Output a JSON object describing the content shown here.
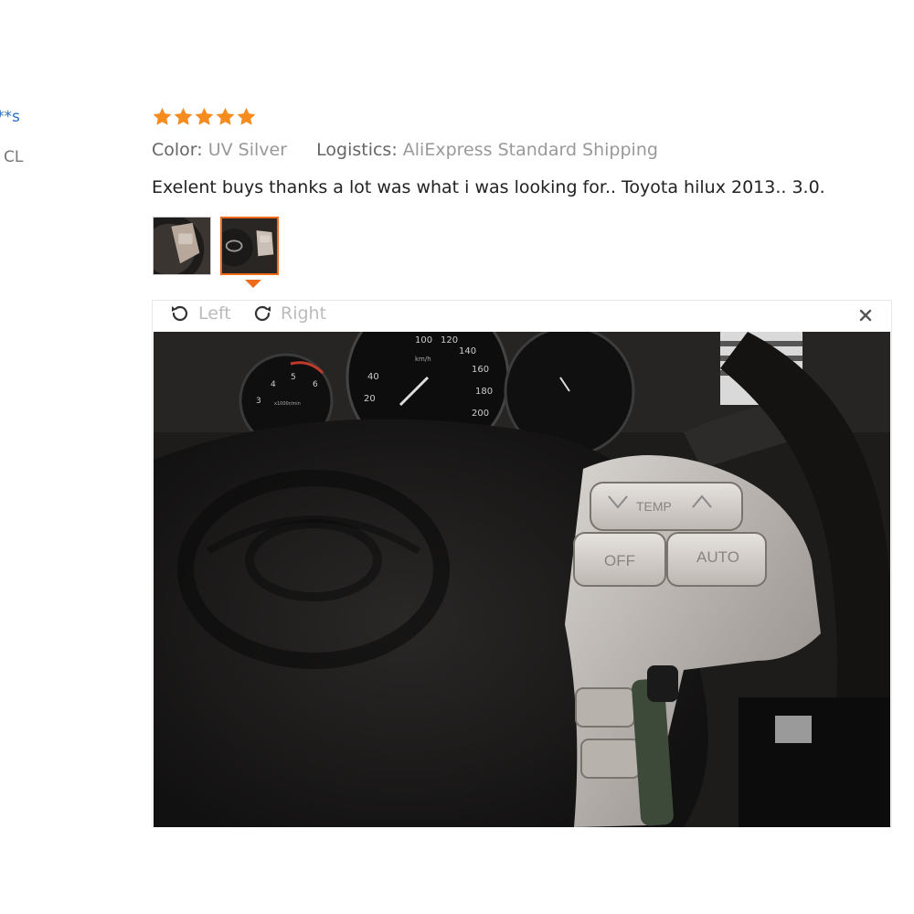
{
  "reviewer": {
    "name": "**s",
    "country": "CL"
  },
  "review": {
    "rating": 5,
    "color_label": "Color:",
    "color_value": "UV Silver",
    "logistics_label": "Logistics:",
    "logistics_value": "AliExpress Standard Shipping",
    "text": "Exelent buys thanks a lot was what i was looking for.. Toyota hilux 2013.. 3.0."
  },
  "viewer": {
    "rotate_left_label": "Left",
    "rotate_right_label": "Right"
  },
  "photo_labels": {
    "temp": "TEMP",
    "off": "OFF",
    "auto": "AUTO",
    "kmh": "km/h",
    "rpm": "x1000r/min",
    "speed_ticks": [
      "20",
      "40",
      "100",
      "120",
      "140",
      "160",
      "180",
      "200"
    ],
    "rpm_ticks": [
      "3",
      "4",
      "5",
      "6"
    ]
  },
  "colors": {
    "star": "#f68b1e",
    "link": "#2a6ec4",
    "accent": "#f06a1a"
  },
  "icons": [
    "star-icon",
    "rotate-left-icon",
    "rotate-right-icon",
    "close-icon"
  ]
}
